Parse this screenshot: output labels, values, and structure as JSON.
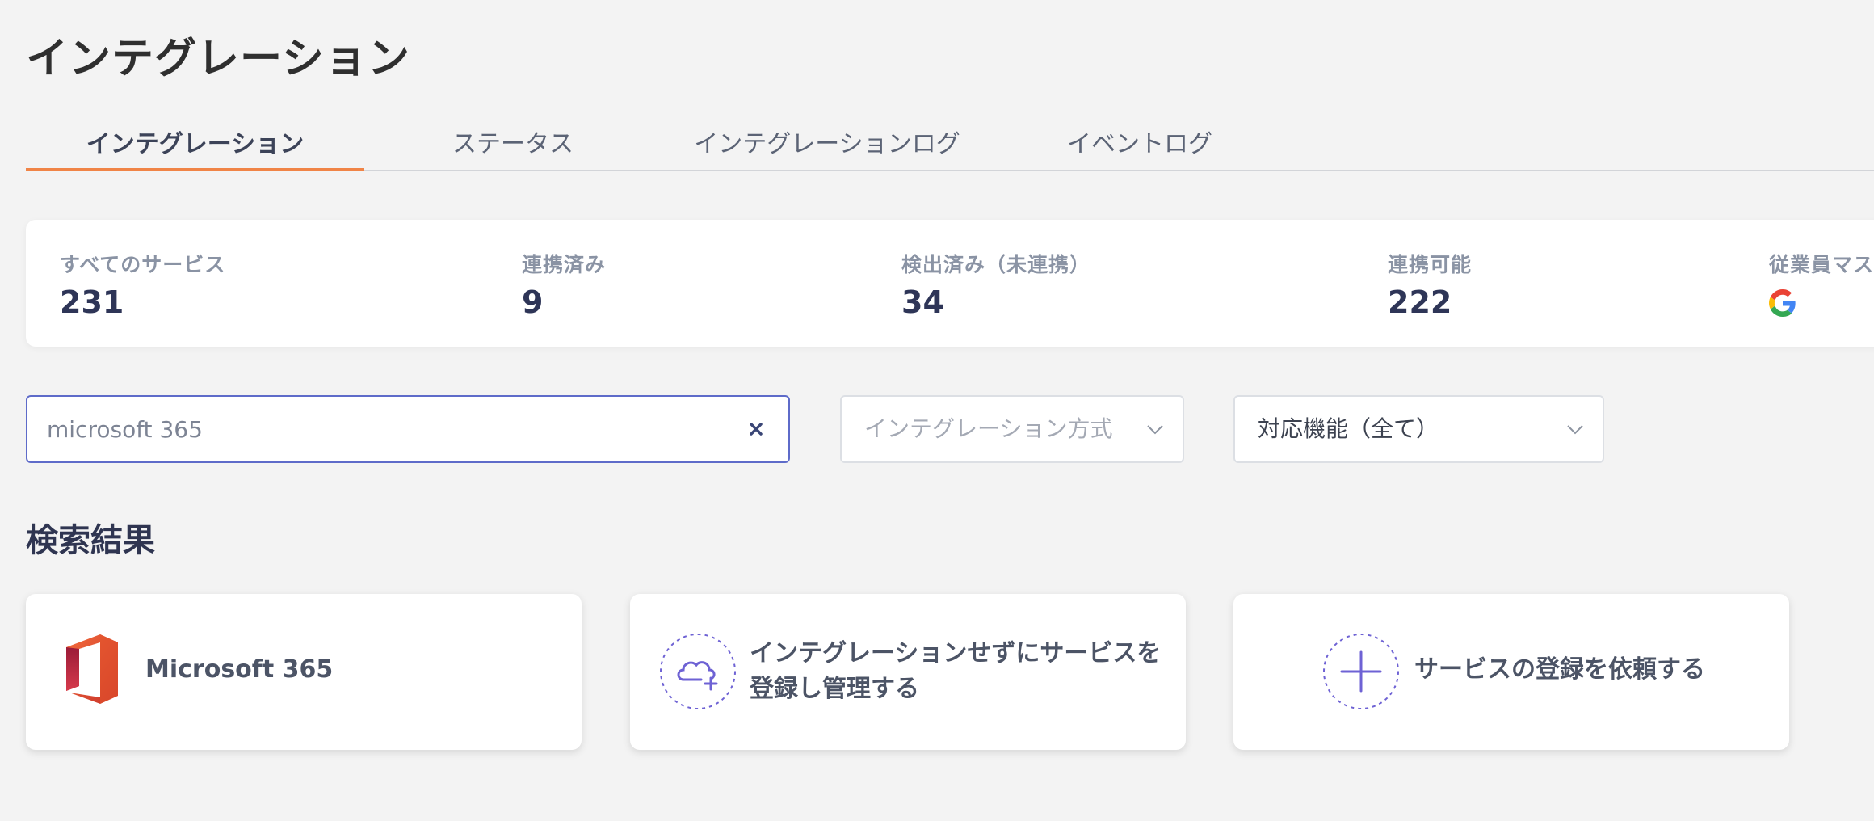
{
  "page": {
    "title": "インテグレーション"
  },
  "tabs": [
    {
      "label": "インテグレーション",
      "active": true
    },
    {
      "label": "ステータス",
      "active": false
    },
    {
      "label": "インテグレーションログ",
      "active": false
    },
    {
      "label": "イベントログ",
      "active": false
    }
  ],
  "stats": [
    {
      "label": "すべてのサービス",
      "value": "231"
    },
    {
      "label": "連携済み",
      "value": "9"
    },
    {
      "label": "検出済み（未連携）",
      "value": "34"
    },
    {
      "label": "連携可能",
      "value": "222"
    },
    {
      "label": "従業員マス",
      "icon": "google-g-icon"
    }
  ],
  "search": {
    "value": "microsoft 365"
  },
  "filters": {
    "method_placeholder": "インテグレーション方式",
    "feature_value": "対応機能（全て）"
  },
  "results": {
    "title": "検索結果",
    "cards": [
      {
        "label": "Microsoft 365",
        "icon": "microsoft-office-icon"
      },
      {
        "label_line1": "インテグレーションせずにサービスを",
        "label_line2": "登録し管理する",
        "icon": "cloud-plus-icon"
      },
      {
        "label": "サービスの登録を依頼する",
        "icon": "plus-icon"
      }
    ]
  },
  "colors": {
    "accent": "#f08446",
    "search_border": "#5e6bc9",
    "stat_value": "#2e3557",
    "icon_purple": "#6e62d4"
  }
}
